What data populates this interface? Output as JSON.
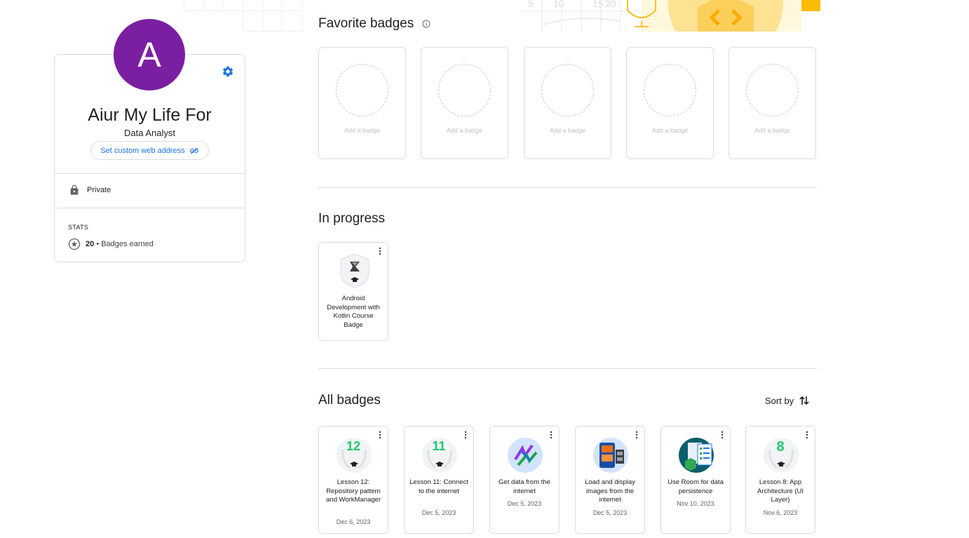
{
  "profile": {
    "avatar_letter": "A",
    "avatar_color": "#7b1fa2",
    "name": "Aiur My Life For",
    "role": "Data Analyst",
    "web_address_button": "Set custom web address",
    "privacy_label": "Private",
    "stats_heading": "STATS",
    "badges_count": "20",
    "badges_earned_label": "• Badges earned"
  },
  "favorites": {
    "title": "Favorite badges",
    "slots": [
      "Add a badge",
      "Add a badge",
      "Add a badge",
      "Add a badge",
      "Add a badge"
    ]
  },
  "in_progress": {
    "title": "In progress",
    "items": [
      {
        "title": "Android Development with Kotlin Course Badge"
      }
    ]
  },
  "all_badges": {
    "title": "All badges",
    "sort_label": "Sort by",
    "items": [
      {
        "title": "Lesson 12: Repository pattern and WorkManager",
        "date": "Dec 6, 2023",
        "number": "12"
      },
      {
        "title": "Lesson 11: Connect to the internet",
        "date": "Dec 5, 2023",
        "number": "11"
      },
      {
        "title": "Get data from the internet",
        "date": "Dec 5, 2023"
      },
      {
        "title": "Load and display images from the internet",
        "date": "Dec 5, 2023"
      },
      {
        "title": "Use Room for data persistence",
        "date": "Nov 10, 2023"
      },
      {
        "title": "Lesson 8: App Architecture (UI Layer)",
        "date": "Nov 6, 2023",
        "number": "8"
      }
    ]
  },
  "colors": {
    "accent": "#1a73e8",
    "lesson_number": "#1ec96b",
    "banner_yellow": "#fbc02d"
  },
  "icons": [
    "gear-icon",
    "info-icon",
    "lock-icon",
    "star-badge-icon",
    "link-icon",
    "kebab-menu-icon",
    "sort-icon"
  ]
}
